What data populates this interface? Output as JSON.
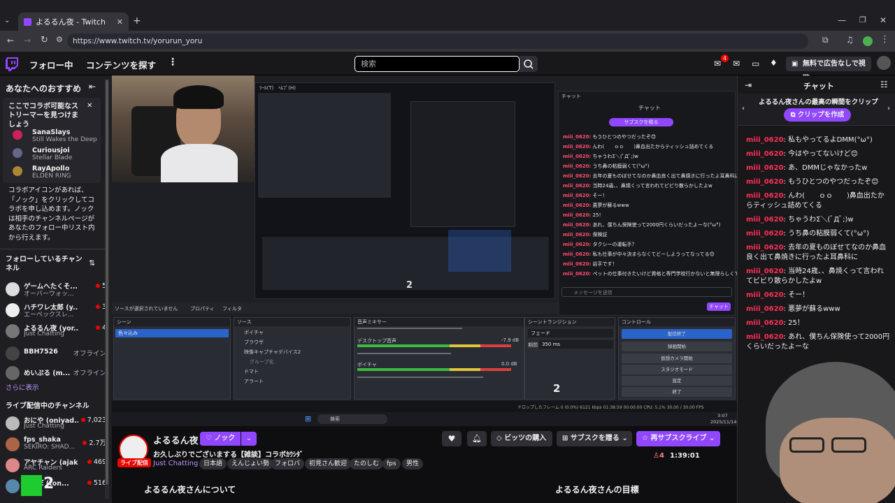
{
  "browser": {
    "tab_title": "よるるん夜 - Twitch",
    "url": "https://www.twitch.tv/yorurun_yoru",
    "new_tab": "+"
  },
  "topnav": {
    "following": "フォロー中",
    "browse": "コンテンツを探す",
    "more": "⋮",
    "search_placeholder": "検索",
    "notif_count": "4",
    "ad_free": "無料で広告なしで視聴"
  },
  "sidebar": {
    "recommend_title": "あなたへのおすすめ",
    "collab_title": "ここでコラボ可能なストリーマーを見つけましょう",
    "collab_streamers": [
      {
        "name": "SanaSlays",
        "game": "Still Wakes the Deep"
      },
      {
        "name": "Curiousjoi",
        "game": "Stellar Blade"
      },
      {
        "name": "RayApollo",
        "game": "ELDEN RING"
      }
    ],
    "collab_desc": "コラボアイコンがあれば、「ノック」をクリックしてコラボを申し込めます。ノックは相手のチャンネルページがあなたのフォロー中リスト内から行えます。",
    "following_title": "フォローしているチャンネル",
    "following": [
      {
        "name": "ゲームへたくそ...",
        "sub": "オーバーウォッ...",
        "count": "5"
      },
      {
        "name": "ハチワレ太郎 (y...",
        "sub": "エーペックスレ...",
        "count": "3"
      },
      {
        "name": "よるるん夜 (yor...",
        "sub": "Just Chatting",
        "count": "4"
      },
      {
        "name": "BBH7526",
        "sub": "",
        "status": "オフライン"
      },
      {
        "name": "めいぷる (m...",
        "sub": "",
        "status": "オフライン"
      }
    ],
    "show_more": "さらに表示",
    "live_title": "ライブ配信中のチャンネル",
    "live": [
      {
        "name": "おにや (oniyad...",
        "sub": "Just Chatting",
        "count": "7,023"
      },
      {
        "name": "fps_shaka",
        "sub": "SEKIRO: SHAD...",
        "count": "2.7万"
      },
      {
        "name": "アヤチャン (ajak...",
        "sub": "ARC Raiders",
        "count": "469"
      },
      {
        "name": "とんぼ (ton...",
        "sub": "",
        "count": "516"
      }
    ]
  },
  "stream": {
    "obs_scene_header": "シーン",
    "obs_scene_item": "色々込み",
    "obs_sources_header": "ソース",
    "obs_sources": [
      "ボイチャ",
      "ブラウザ",
      "映像キャプチャデバイス2",
      "グループ化",
      "ドマト",
      "アラート"
    ],
    "obs_mixer_header": "音声ミキサー",
    "obs_mixer_items": [
      {
        "name": "デスクトップ音声",
        "db": "-7.9 dB"
      },
      {
        "name": "ボイチャ",
        "db": "0.0 dB"
      }
    ],
    "obs_transition_header": "シーントランジション",
    "obs_transition_value": "フェード",
    "obs_duration_label": "期間",
    "obs_duration": "350 ms",
    "obs_controls_header": "コントロール",
    "obs_controls": [
      "配信終了",
      "録画開始",
      "仮想カメラ開始",
      "スタジオモード",
      "設定",
      "終了"
    ],
    "obs_no_source": "ソースが選択されていません",
    "obs_props": "プロパティ",
    "obs_filter": "フィルタ",
    "obs_status": "ドロップしたフレーム 0 (0.0%)  6121 kbps  01:38:59  00:00:00  CPU: 5.1%  30.00 / 30.00 FPS",
    "obs_chat_title": "チャット",
    "obs_sub_button": "サブスクを贈る",
    "obs_chat_lines": [
      {
        "u": "miii_0620:",
        "m": "もうひとつのやつだったぞ😊"
      },
      {
        "u": "miii_0620:",
        "m": "んわ(　　ｏｏ　　)鼻血出たからティッシュ詰めてくる"
      },
      {
        "u": "miii_0620:",
        "m": "ちゃうわΣ＼(ﾟДﾟ;)w"
      },
      {
        "u": "miii_0620:",
        "m": "うち鼻の粘膜弱くて(°ω°)"
      },
      {
        "u": "miii_0620:",
        "m": "去年の夏ものぼせてなのか鼻血良く出て鼻焼きに行ったよ耳鼻科に"
      },
      {
        "u": "miii_0620:",
        "m": "当時24歳、、鼻焼くって言われてビビり散らかしたよw"
      },
      {
        "u": "miii_0620:",
        "m": "そー！"
      },
      {
        "u": "miii_0620:",
        "m": "悪夢が蘇るwww"
      },
      {
        "u": "miii_0620:",
        "m": "25！"
      },
      {
        "u": "miii_0620:",
        "m": "あれ、僕ちん保険使って2000円くらいだったよーな(°ω°)"
      },
      {
        "u": "miii_0620:",
        "m": "保険証"
      },
      {
        "u": "miii_0620:",
        "m": "タクシーの運転手？"
      },
      {
        "u": "miii_0620:",
        "m": "私も仕事が中々決まらなくてどーしようってなってる😊"
      },
      {
        "u": "miii_0620:",
        "m": "岩手です！"
      },
      {
        "u": "miii_0620:",
        "m": "ペットの仕事付きたいけど資格と専門学校行かないと無理らしくて😊"
      }
    ],
    "obs_chat_input": "メッセージを送信",
    "obs_chat_send": "チャット",
    "taskbar_search": "検索",
    "time": "3:07",
    "date": "2025/11/14",
    "overlay_badge": "2",
    "watermark": "2"
  },
  "info": {
    "channel_name": "よるるん夜",
    "follow_button": "ノック",
    "title": "お久しぶりでございまする【雑談】コラボｶｳｼﾀﾞ",
    "live_badge": "ライブ配信",
    "category": "Just Chatting",
    "tags": [
      "日本語",
      "えんじょい勢",
      "フォロバ",
      "初見さん歓迎",
      "たのしむ",
      "fps",
      "男性"
    ],
    "bits_button": "ビッツの購入",
    "gift_button": "サブスクを贈る",
    "resub_button": "再サブスクライブ",
    "viewers": "4",
    "uptime": "1:39:01",
    "about": "よるるん夜さんについて",
    "goals": "よるるん夜さんの目標"
  },
  "chat": {
    "title": "チャット",
    "clip_banner": "よるるん夜さんの最高の瞬間をクリップ",
    "clip_button": "クリップを作成",
    "messages": [
      {
        "user": "miii_0620",
        "text": "私もやってるよDMM(°ω°)"
      },
      {
        "user": "miii_0620",
        "text": "今はやってないけど😊"
      },
      {
        "user": "miii_0620",
        "text": "あ、DMMじゃなかったw"
      },
      {
        "user": "miii_0620",
        "text": "もうひとつのやつだったぞ😊"
      },
      {
        "user": "miii_0620",
        "text": "んわ(　　ｏｏ　　)鼻血出たからティッシュ詰めてくる"
      },
      {
        "user": "miii_0620",
        "text": "ちゃうわΣ＼(ﾟДﾟ;)w"
      },
      {
        "user": "miii_0620",
        "text": "うち鼻の粘膜弱くて(°ω°)"
      },
      {
        "user": "miii_0620",
        "text": "去年の夏ものぼせてなのか鼻血良く出て鼻焼きに行ったよ耳鼻科に"
      },
      {
        "user": "miii_0620",
        "text": "当時24歳、、鼻焼くって言われてビビり散らかしたよw"
      },
      {
        "user": "miii_0620",
        "text": "そー！"
      },
      {
        "user": "miii_0620",
        "text": "悪夢が蘇るwww"
      },
      {
        "user": "miii_0620",
        "text": "25！"
      },
      {
        "user": "miii_0620",
        "text": "あれ、僕ちん保険使って2000円くらいだったよーな"
      }
    ]
  },
  "colors": {
    "accent": "#9147ff",
    "live": "#eb0400",
    "username": "#ff2d55",
    "obs_blue": "#2a63c9"
  }
}
